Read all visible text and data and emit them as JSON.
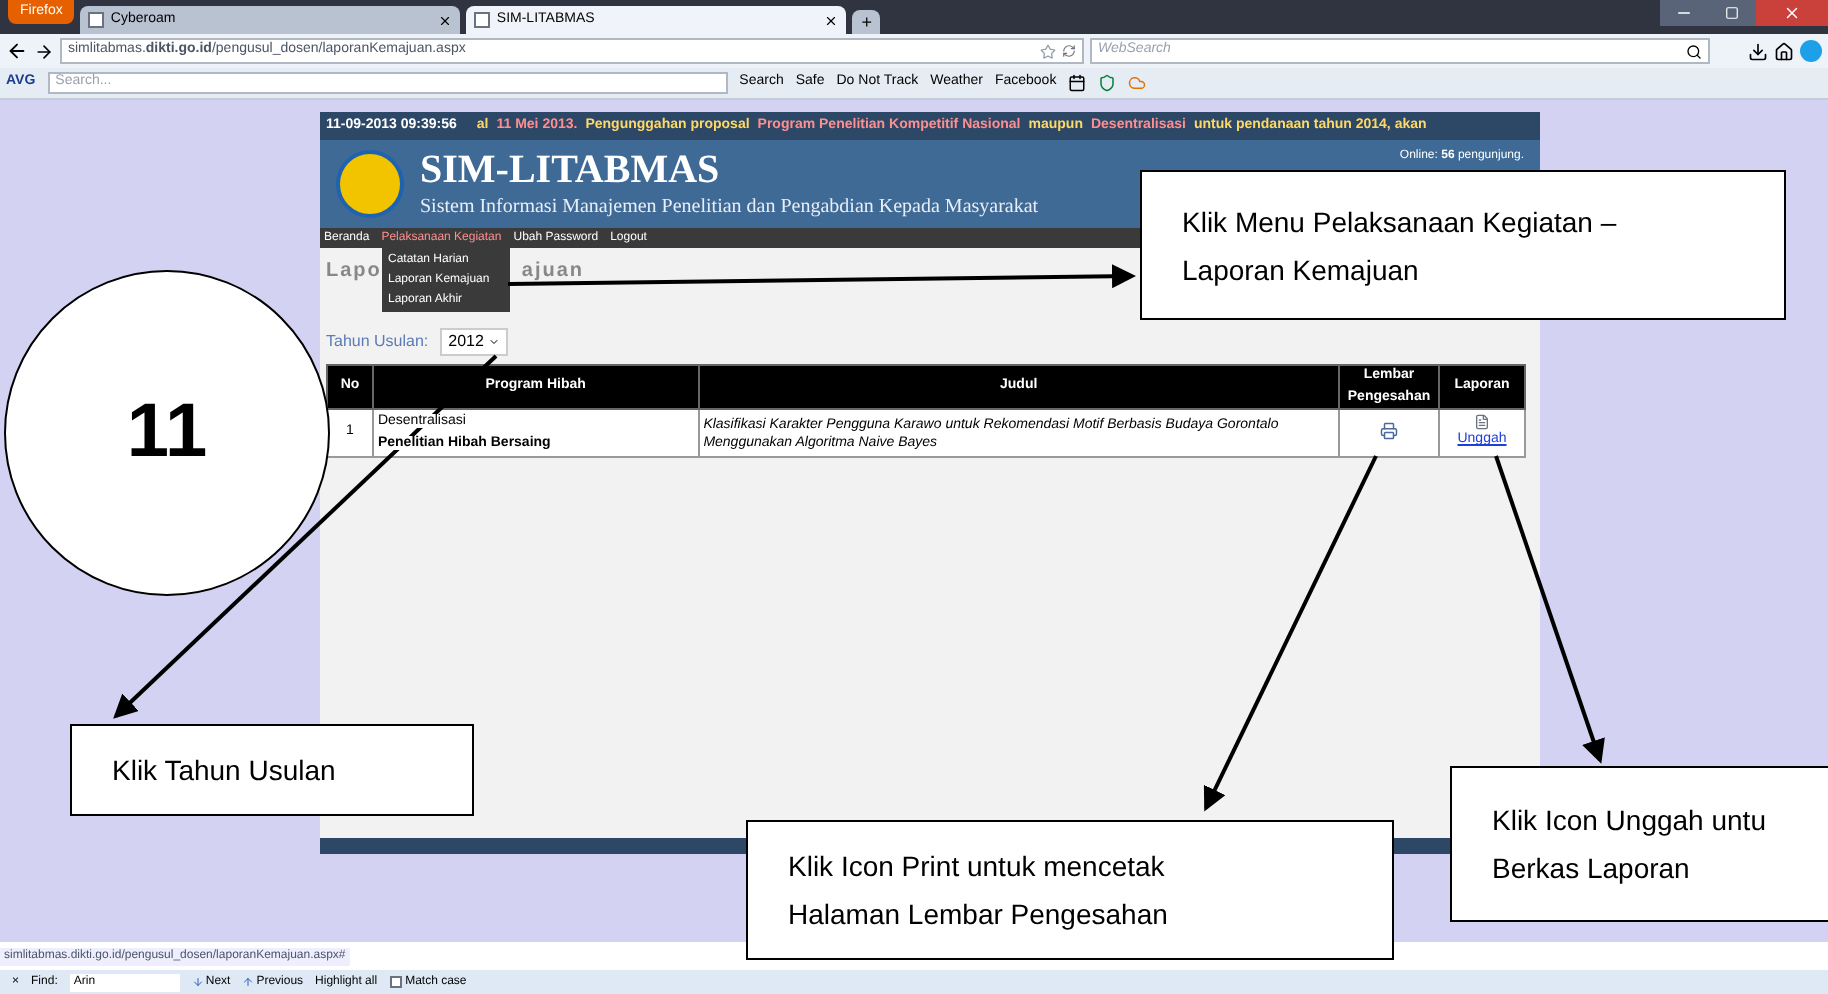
{
  "browser": {
    "menu_button": "Firefox",
    "tabs": [
      {
        "title": "Cyberoam",
        "selected": false
      },
      {
        "title": "SIM-LITABMAS",
        "selected": true
      }
    ],
    "new_tab": "+",
    "url": "simlitabmas.**dikti.go.id**/pengusul_dosen/laporanKemajuan.aspx",
    "search_placeholder": "WebSearch",
    "toolbar": {
      "brand": "AVG",
      "search_placeholder": "Search...",
      "items": [
        "Search",
        "Safe",
        "Do Not Track",
        "Weather",
        "Facebook"
      ]
    }
  },
  "page": {
    "datetime": "11-09-2013  09:39:56",
    "ticker": [
      {
        "text": "al",
        "color": "#ffd966"
      },
      {
        "text": "11 Mei 2013.",
        "color": "#ff8f8f"
      },
      {
        "text": "Pengunggahan proposal",
        "color": "#ffd966"
      },
      {
        "text": "Program Penelitian Kompetitif Nasional",
        "color": "#ff8f8f"
      },
      {
        "text": "maupun",
        "color": "#ffd966"
      },
      {
        "text": "Desentralisasi",
        "color": "#ff8f8f"
      },
      {
        "text": "untuk pendanaan tahun 2014, akan",
        "color": "#ffd966"
      }
    ],
    "site_title": "SIM-LITABMAS",
    "subtitle": "Sistem Informasi Manajemen Penelitian dan Pengabdian Kepada Masyarakat",
    "online": "Online: **56** pengunjung.",
    "nav": [
      {
        "label": "Beranda",
        "selected": false
      },
      {
        "label": "Pelaksanaan Kegiatan",
        "selected": true
      },
      {
        "label": "Ubah Password",
        "selected": false
      },
      {
        "label": "Logout",
        "selected": false
      }
    ],
    "submenu": [
      "Catatan Harian",
      "Laporan Kemajuan",
      "Laporan Akhir"
    ],
    "title_start": "Lapo",
    "title_end": "ajuan",
    "filter": {
      "label": "Tahun Usulan:",
      "value": "2012"
    },
    "table": {
      "columns": [
        "No",
        "Program Hibah",
        "Judul",
        "Lembar Pengesahan",
        "Laporan"
      ],
      "rows": [
        {
          "no": "1",
          "program": "Desentralisasi",
          "program_name": "Penelitian Hibah Bersaing",
          "judul": "Klasifikasi Karakter Pengguna Karawo untuk Rekomendasi Motif Berbasis Budaya Gorontalo Menggunakan Algoritma Naive Bayes",
          "laporan_link": "Unggah"
        }
      ]
    }
  },
  "annotations": {
    "step": "11",
    "callouts": [
      {
        "lines": [
          "Klik Menu Pelaksanaan Kegiatan –",
          "Laporan Kemajuan"
        ]
      },
      {
        "lines": [
          "Klik Tahun Usulan"
        ]
      },
      {
        "lines": [
          "Klik Icon Print untuk mencetak",
          "Halaman Lembar Pengesahan"
        ]
      },
      {
        "lines": [
          "Klik Icon Unggah untu",
          "Berkas Laporan"
        ]
      }
    ]
  },
  "status_url": "simlitabmas.dikti.go.id/pengusul_dosen/laporanKemajuan.aspx#",
  "find_bar": {
    "close": "×",
    "label": "Find:",
    "value": "Arin",
    "next": "Next",
    "previous": "Previous",
    "highlight_all": "Highlight all",
    "match_case": {
      "label": "Match case",
      "checked": false
    }
  }
}
